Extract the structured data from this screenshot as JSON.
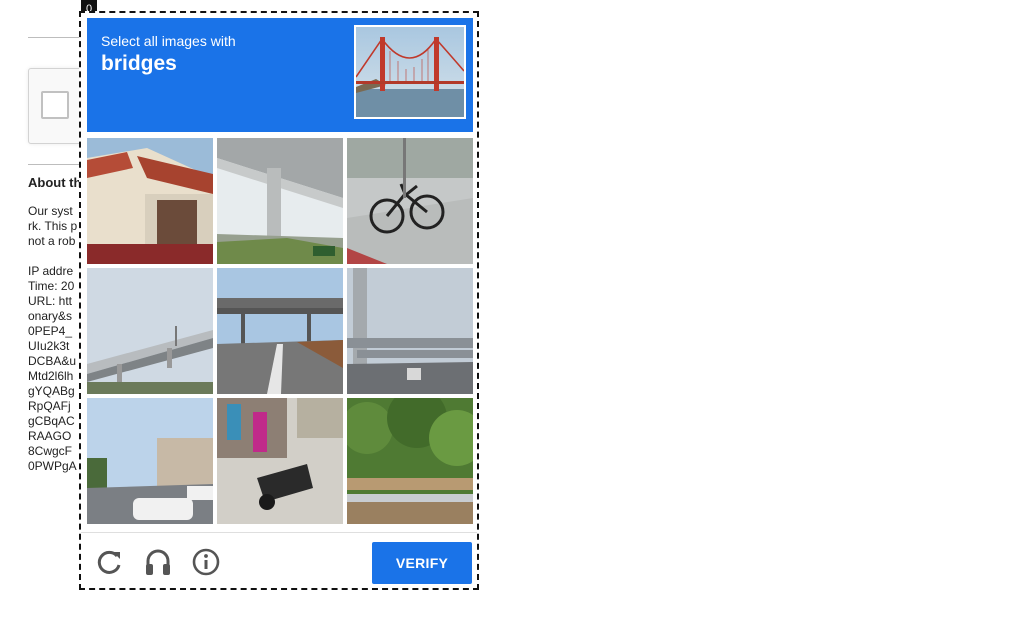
{
  "background": {
    "about_title": "About th",
    "text_lines": [
      "Our syst",
      "rk. This p",
      "not a rob",
      "",
      "IP addre",
      "Time: 20",
      "URL: htt",
      "onary&s",
      "0PEP4_",
      "UIu2k3t",
      "DCBA&u",
      "Mtd2l6lh",
      "gYQABg",
      "RpQAFj",
      "gCBqAC",
      "RAAGO",
      "8CwgcF",
      "0PWPgA"
    ]
  },
  "challenge": {
    "frame_index": "0",
    "instruction": "Select all images with",
    "target": "bridges",
    "verify_label": "VERIFY",
    "icons": {
      "reload": "reload-icon",
      "audio": "headphones-icon",
      "info": "info-icon"
    },
    "accent_color": "#1a73e8"
  }
}
